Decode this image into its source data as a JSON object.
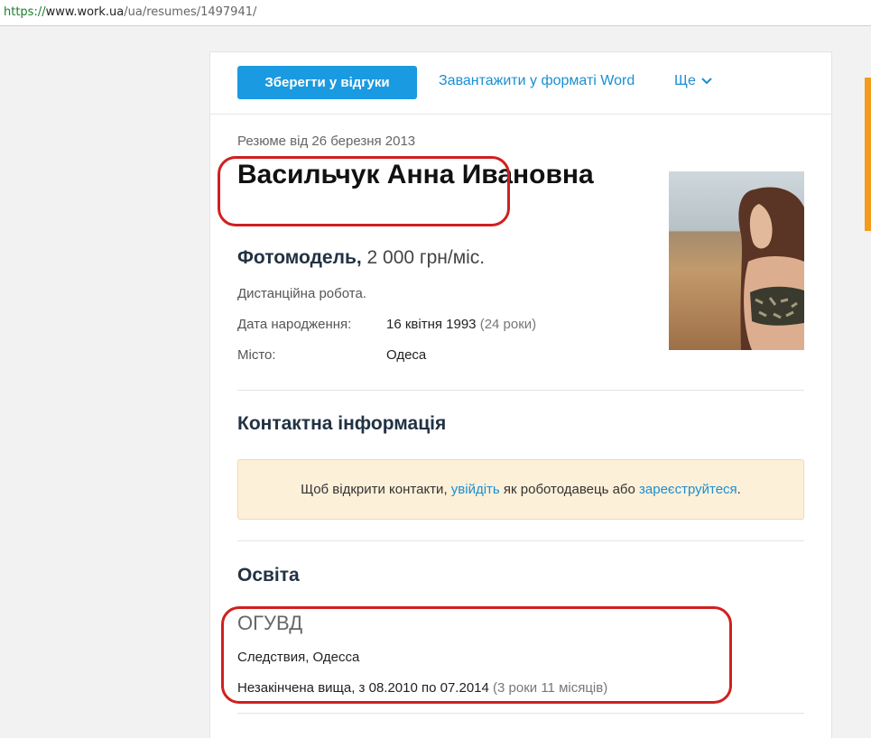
{
  "browser": {
    "url_scheme": "https://",
    "url_host": "www.work.ua",
    "url_path": "/ua/resumes/1497941/"
  },
  "toolbar": {
    "save_label": "Зберегти у відгуки",
    "download_label": "Завантажити у форматі Word",
    "more_label": "Ще"
  },
  "resume": {
    "date_line": "Резюме від 26 березня 2013",
    "name": "Васильчук Анна Ивановна",
    "position": "Фотомодель,",
    "salary": "2 000 грн/міс.",
    "remote": "Дистанційна робота.",
    "birth_label": "Дата народження:",
    "birth_value": "16 квітня 1993",
    "age": "(24 роки)",
    "city_label": "Місто:",
    "city_value": "Одеса"
  },
  "contacts": {
    "title": "Контактна інформація",
    "notice_prefix": "Щоб відкрити контакти, ",
    "login_link": "увійдіть",
    "notice_middle": " як роботодавець або ",
    "register_link": "зареєструйтеся",
    "notice_suffix": "."
  },
  "education": {
    "title": "Освіта",
    "school": "ОГУВД",
    "place": "Следствия, Одесса",
    "period": "Незакінчена вища, з 08.2010 по 07.2014",
    "duration": "(3 роки 11 місяців)"
  },
  "colors": {
    "accent": "#1a9ae0",
    "link": "#1a8fd1",
    "annotation": "#d0201f",
    "notice_bg": "#fdf0d9"
  }
}
